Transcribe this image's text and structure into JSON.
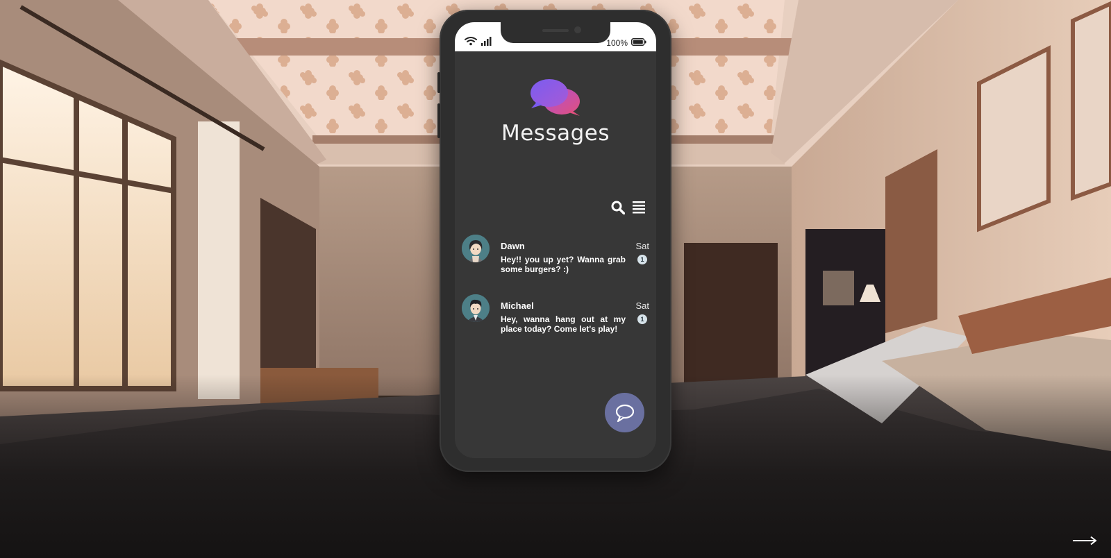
{
  "scene": {
    "background": "anime-bedroom-background",
    "next_icon": "right-arrow-icon"
  },
  "status_bar": {
    "wifi_icon": "wifi-icon",
    "signal_icon": "signal-bars-icon",
    "battery_percent": "100%",
    "battery_icon": "battery-icon"
  },
  "app": {
    "logo_icon": "chat-bubbles-icon",
    "title": "Messages",
    "toolbar": {
      "search_icon": "search-icon",
      "menu_icon": "menu-icon"
    },
    "compose_icon": "chat-bubble-icon",
    "colors": {
      "screen_bg": "#373737",
      "compose_bg": "#6a70a0",
      "logo_gradient_start": "#7b5cf0",
      "logo_gradient_end": "#e0507e"
    }
  },
  "threads": [
    {
      "name": "Dawn",
      "time": "Sat",
      "preview": "Hey!! you up yet? Wanna grab some burgers? :)",
      "unread": "1"
    },
    {
      "name": "Michael",
      "time": "Sat",
      "preview": "Hey, wanna hang out at my place today? Come let's play!",
      "unread": "1"
    }
  ]
}
